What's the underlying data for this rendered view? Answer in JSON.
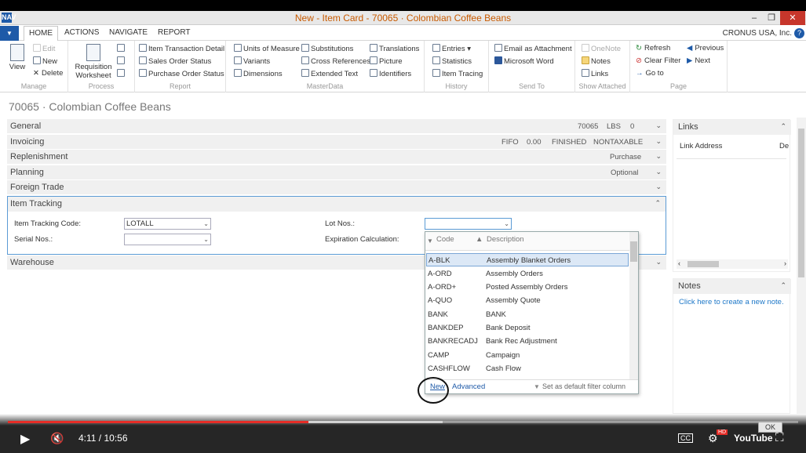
{
  "window": {
    "title": "New - Item Card - 70065 · Colombian Coffee Beans",
    "logo": "NAV",
    "controls": [
      "–",
      "❐",
      "✕"
    ]
  },
  "menubar": {
    "tabs": [
      "HOME",
      "ACTIONS",
      "NAVIGATE",
      "REPORT"
    ],
    "company": "CRONUS USA, Inc.",
    "help": "?"
  },
  "ribbon": {
    "manage": {
      "name": "Manage",
      "view": "View",
      "edit": "Edit",
      "new": "New",
      "delete": "Delete"
    },
    "process": {
      "name": "Process",
      "requisition_l1": "Requisition",
      "requisition_l2": "Worksheet"
    },
    "report": {
      "name": "Report",
      "items": [
        "Item Transaction Detail",
        "Sales Order Status",
        "Purchase Order Status"
      ]
    },
    "masterdata": {
      "name": "MasterData",
      "col1": [
        "Units of Measure",
        "Variants",
        "Dimensions"
      ],
      "col2": [
        "Substitutions",
        "Cross References",
        "Extended Text"
      ],
      "col3": [
        "Translations",
        "Picture",
        "Identifiers"
      ]
    },
    "history": {
      "name": "History",
      "items": [
        "Entries ▾",
        "Statistics",
        "Item Tracing"
      ]
    },
    "sendto": {
      "name": "Send To",
      "items": [
        "Email as Attachment",
        "Microsoft Word"
      ]
    },
    "showattached": {
      "name": "Show Attached",
      "items": [
        "OneNote",
        "Notes",
        "Links"
      ]
    },
    "page": {
      "name": "Page",
      "col1": [
        "Refresh",
        "Clear Filter",
        "Go to"
      ],
      "col2": [
        "Previous",
        "Next"
      ]
    }
  },
  "page_header": "70065 · Colombian Coffee Beans",
  "fasttabs": {
    "general": {
      "name": "General",
      "summary": [
        "70065",
        "LBS",
        "0"
      ]
    },
    "invoicing": {
      "name": "Invoicing",
      "summary": [
        "FIFO",
        "0.00",
        "FINISHED",
        "NONTAXABLE"
      ]
    },
    "replenishment": {
      "name": "Replenishment",
      "summary": [
        "Purchase"
      ]
    },
    "planning": {
      "name": "Planning",
      "summary": [
        "Optional"
      ]
    },
    "foreign_trade": {
      "name": "Foreign Trade"
    },
    "item_tracking": {
      "name": "Item Tracking"
    },
    "warehouse": {
      "name": "Warehouse"
    }
  },
  "item_tracking": {
    "tracking_code_label": "Item Tracking Code:",
    "tracking_code_value": "LOTALL",
    "serial_nos_label": "Serial Nos.:",
    "serial_nos_value": "",
    "lot_nos_label": "Lot Nos.:",
    "lot_nos_value": "",
    "expiration_label": "Expiration Calculation:"
  },
  "lookup": {
    "col_code": "Code",
    "col_description": "Description",
    "rows": [
      {
        "code": "A-BLK",
        "description": "Assembly Blanket Orders"
      },
      {
        "code": "A-ORD",
        "description": "Assembly Orders"
      },
      {
        "code": "A-ORD+",
        "description": "Posted Assembly Orders"
      },
      {
        "code": "A-QUO",
        "description": "Assembly Quote"
      },
      {
        "code": "BANK",
        "description": "BANK"
      },
      {
        "code": "BANKDEP",
        "description": "Bank Deposit"
      },
      {
        "code": "BANKRECADJ",
        "description": "Bank Rec Adjustment"
      },
      {
        "code": "CAMP",
        "description": "Campaign"
      },
      {
        "code": "CASHFLOW",
        "description": "Cash Flow"
      }
    ],
    "new_link": "New",
    "advanced_link": "Advanced",
    "default_filter": "Set as default filter column"
  },
  "factbox": {
    "links": {
      "title": "Links",
      "col1": "Link Address",
      "col2": "De"
    },
    "notes": {
      "title": "Notes",
      "link": "Click here to create a new note."
    }
  },
  "video": {
    "time": "4:11 / 10:56",
    "played_fraction": 0.38,
    "buffered_fraction": 0.55,
    "cc": "CC",
    "hd": "HD",
    "youtube": "YouTube",
    "ok": "OK"
  }
}
